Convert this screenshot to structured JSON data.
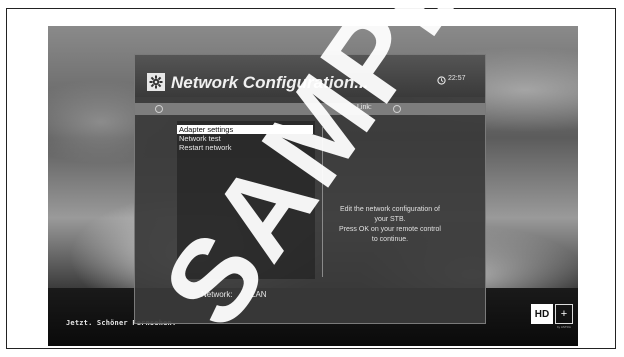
{
  "header": {
    "title": "Network Configuration...",
    "time": "22:57"
  },
  "status_bar": {
    "link_label": "Link:"
  },
  "menu": {
    "items": [
      {
        "label": "Adapter settings",
        "selected": true
      },
      {
        "label": "Network test",
        "selected": false
      },
      {
        "label": "Restart network",
        "selected": false
      }
    ]
  },
  "description": {
    "lines": [
      "Edit the network configuration of",
      "your STB.",
      "Press OK on your remote control",
      "to continue."
    ]
  },
  "footer": {
    "network_label": "Network:",
    "network_value": "LAN"
  },
  "ticker": {
    "text": "Jetzt. Schöner Fernsehen."
  },
  "logo": {
    "hd": "HD",
    "plus": "+",
    "sub": "by ASTRA"
  },
  "watermark": {
    "text": "SAMPLE"
  },
  "icons": {
    "gear": "gear-icon",
    "clock": "clock-icon",
    "radio": "radio-icon"
  }
}
